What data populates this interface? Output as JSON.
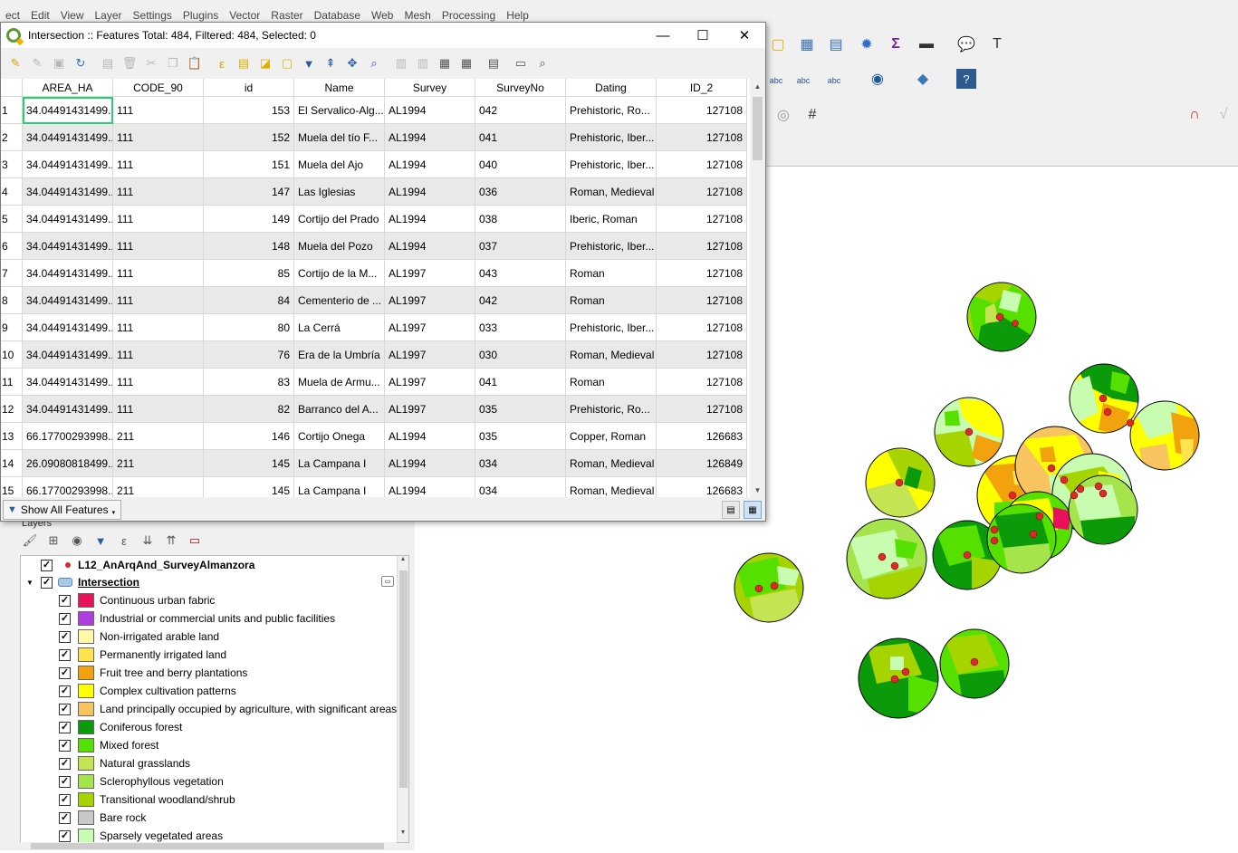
{
  "main_menu": [
    "ect",
    "Edit",
    "View",
    "Layer",
    "Settings",
    "Plugins",
    "Vector",
    "Raster",
    "Database",
    "Web",
    "Mesh",
    "Processing",
    "Help"
  ],
  "dialog": {
    "title": "Intersection :: Features Total: 484, Filtered: 484, Selected: 0",
    "minimize_icon": "—",
    "maximize_icon": "☐",
    "close_icon": "✕"
  },
  "table": {
    "columns": [
      "AREA_HA",
      "CODE_90",
      "id",
      "Name",
      "Survey",
      "SurveyNo",
      "Dating",
      "ID_2"
    ],
    "rows": [
      [
        "1",
        "34.04491431499...",
        "111",
        "153",
        "El Servalico-Alg...",
        "AL1994",
        "042",
        "Prehistoric, Ro...",
        "127108"
      ],
      [
        "2",
        "34.04491431499...",
        "111",
        "152",
        "Muela del tío F...",
        "AL1994",
        "041",
        "Prehistoric, Iber...",
        "127108"
      ],
      [
        "3",
        "34.04491431499...",
        "111",
        "151",
        "Muela del Ajo",
        "AL1994",
        "040",
        "Prehistoric, Iber...",
        "127108"
      ],
      [
        "4",
        "34.04491431499...",
        "111",
        "147",
        "Las Iglesias",
        "AL1994",
        "036",
        "Roman, Medieval",
        "127108"
      ],
      [
        "5",
        "34.04491431499...",
        "111",
        "149",
        "Cortijo del Prado",
        "AL1994",
        "038",
        "Iberic, Roman",
        "127108"
      ],
      [
        "6",
        "34.04491431499...",
        "111",
        "148",
        "Muela del Pozo",
        "AL1994",
        "037",
        "Prehistoric, Iber...",
        "127108"
      ],
      [
        "7",
        "34.04491431499...",
        "111",
        "85",
        "Cortijo de la M...",
        "AL1997",
        "043",
        "Roman",
        "127108"
      ],
      [
        "8",
        "34.04491431499...",
        "111",
        "84",
        "Cementerio de ...",
        "AL1997",
        "042",
        "Roman",
        "127108"
      ],
      [
        "9",
        "34.04491431499...",
        "111",
        "80",
        "La Cerrá",
        "AL1997",
        "033",
        "Prehistoric, Iber...",
        "127108"
      ],
      [
        "10",
        "34.04491431499...",
        "111",
        "76",
        "Era de la Umbría",
        "AL1997",
        "030",
        "Roman, Medieval",
        "127108"
      ],
      [
        "11",
        "34.04491431499...",
        "111",
        "83",
        "Muela de Armu...",
        "AL1997",
        "041",
        "Roman",
        "127108"
      ],
      [
        "12",
        "34.04491431499...",
        "111",
        "82",
        "Barranco del A...",
        "AL1997",
        "035",
        "Prehistoric, Ro...",
        "127108"
      ],
      [
        "13",
        "66.17700293998...",
        "211",
        "146",
        "Cortijo Onega",
        "AL1994",
        "035",
        "Copper, Roman",
        "126683"
      ],
      [
        "14",
        "26.09080818499...",
        "211",
        "145",
        "La Campana I",
        "AL1994",
        "034",
        "Roman, Medieval",
        "126849"
      ],
      [
        "15",
        "66.17700293998...",
        "211",
        "145",
        "La Campana I",
        "AL1994",
        "034",
        "Roman, Medieval",
        "126683"
      ]
    ]
  },
  "status_bar": {
    "filter_button": "Show All Features"
  },
  "layers": {
    "panel_title": "Layers",
    "point_layer": "L12_AnArqAnd_SurveyAlmanzora",
    "polygon_layer": "Intersection",
    "classes": [
      {
        "label": "Continuous urban fabric",
        "color": "#e8115a"
      },
      {
        "label": "Industrial or commercial units and public facilities",
        "color": "#b03de0"
      },
      {
        "label": "Non-irrigated arable land",
        "color": "#fffaa8"
      },
      {
        "label": "Permanently irrigated land",
        "color": "#ffe34f"
      },
      {
        "label": "Fruit tree and berry plantations",
        "color": "#f2a20c"
      },
      {
        "label": "Complex cultivation patterns",
        "color": "#ffff00"
      },
      {
        "label": "Land principally occupied by agriculture, with significant areas",
        "color": "#f7c460"
      },
      {
        "label": "Coniferous forest",
        "color": "#0a9a0a"
      },
      {
        "label": "Mixed forest",
        "color": "#55e000"
      },
      {
        "label": "Natural grasslands",
        "color": "#c5e454"
      },
      {
        "label": "Sclerophyllous vegetation",
        "color": "#a6e44c"
      },
      {
        "label": "Transitional woodland/shrub",
        "color": "#a6d400"
      },
      {
        "label": "Bare rock",
        "color": "#c8c8c8"
      },
      {
        "label": "Sparsely vegetated areas",
        "color": "#c8fcb0"
      }
    ]
  },
  "map": {
    "point_color": "#e0282a"
  }
}
